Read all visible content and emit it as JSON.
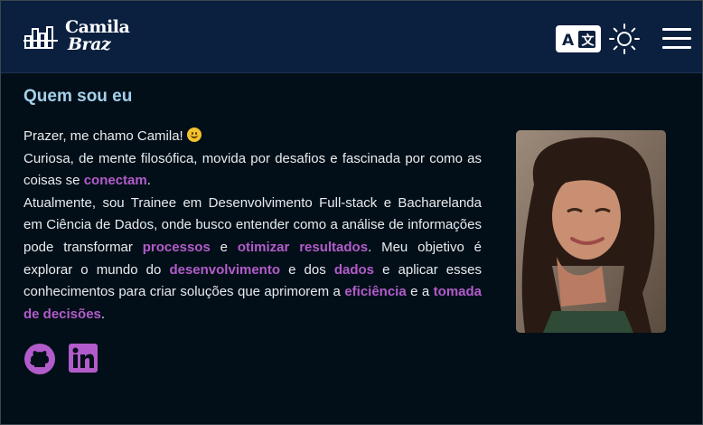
{
  "header": {
    "logo": {
      "line1": "Camila",
      "line2": "Braz"
    },
    "icons": {
      "translate": "translate-icon",
      "theme": "sun-icon",
      "menu": "hamburger-menu-icon"
    }
  },
  "about": {
    "title": "Quem sou eu",
    "greeting": "Prazer, me chamo Camila! ",
    "line2_part1": "Curiosa, de mente filosófica, movida por desafios e fascinada por como as coisas se ",
    "hl_conectam": "conectam",
    "line2_end": ".",
    "p3_part1": "Atualmente, sou Trainee em Desenvolvimento Full-stack e Bacharelanda em Ciência de Dados, onde busco entender como a análise de informações pode transformar ",
    "hl_processos": "processos",
    "p3_and1": " e ",
    "hl_otimizar": "otimizar resultados",
    "p3_part2": ". Meu objetivo é explorar o mundo do ",
    "hl_desenvolvimento": "desenvolvimento",
    "p3_and2": " e dos ",
    "hl_dados": "dados",
    "p3_part3": " e aplicar esses conhecimentos para criar soluções que aprimorem a ",
    "hl_eficiencia": "eficiência",
    "p3_and3": " e a ",
    "hl_tomada": "tomada de decisões",
    "p3_end": "."
  },
  "socials": [
    {
      "name": "github-icon"
    },
    {
      "name": "linkedin-icon"
    }
  ],
  "colors": {
    "background": "#030f18",
    "header": "#0b1f3f",
    "title": "#a5d0ea",
    "highlight": "#b25ccb"
  }
}
